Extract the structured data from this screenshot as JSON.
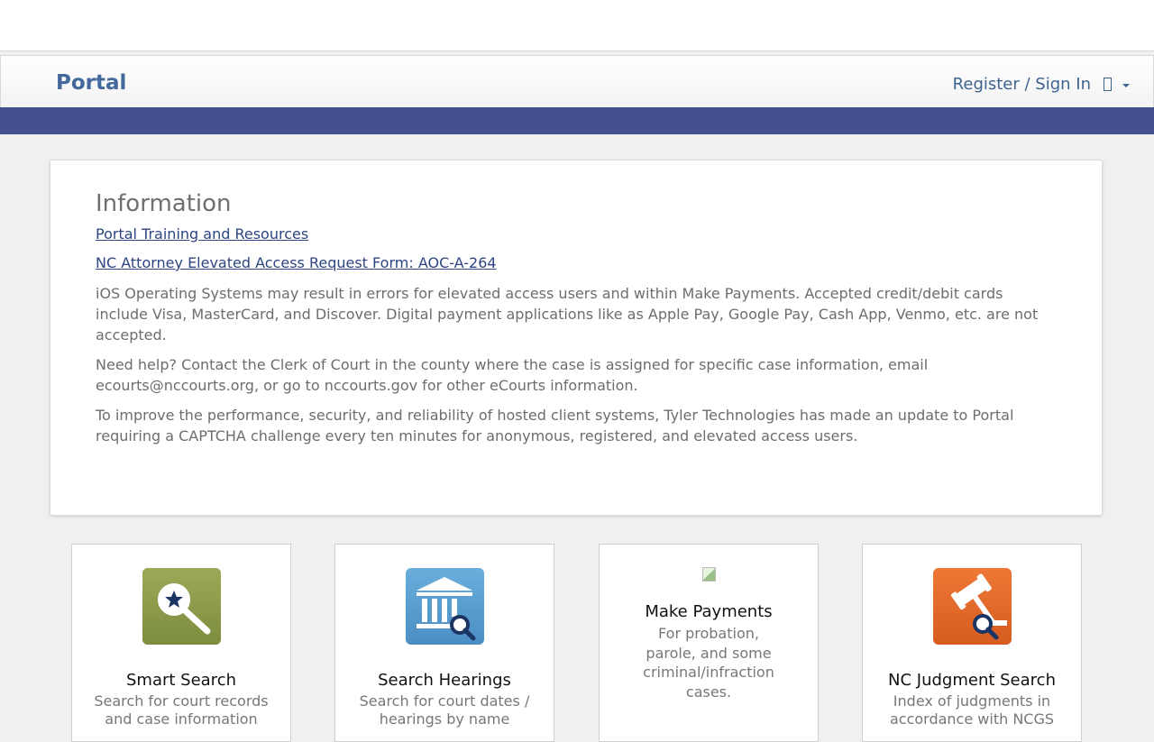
{
  "header": {
    "brand": "Portal",
    "signin_label": "Register / Sign In"
  },
  "info": {
    "heading": "Information",
    "links": [
      "Portal Training and Resources",
      "NC Attorney Elevated Access Request Form: AOC-A-264"
    ],
    "paragraphs": [
      "iOS Operating Systems may result in errors for elevated access users and within Make Payments. Accepted credit/debit cards include Visa, MasterCard, and Discover. Digital payment applications like as Apple Pay, Google Pay, Cash App, Venmo, etc. are not accepted.",
      "Need help? Contact the Clerk of Court in the county where the case is assigned for specific case information, email ecourts@nccourts.org, or go to nccourts.gov for other eCourts information.",
      "To improve the performance, security, and reliability of hosted client systems, Tyler Technologies has made an update to Portal requiring a CAPTCHA challenge every ten minutes for anonymous, registered, and elevated access users."
    ]
  },
  "tiles": [
    {
      "title": "Smart Search",
      "desc": "Search for court records and case information",
      "icon": "magnifier-star-icon",
      "color": "#8a9a48"
    },
    {
      "title": "Search Hearings",
      "desc": "Search for court dates / hearings by name",
      "icon": "courthouse-search-icon",
      "color": "#5b9fd0"
    },
    {
      "title": "Make Payments",
      "desc": "For probation, parole, and some criminal/infraction cases.",
      "icon": "broken-image-icon"
    },
    {
      "title": "NC Judgment Search",
      "desc": "Index of judgments in accordance with NCGS",
      "icon": "gavel-search-icon",
      "color": "#e0682a"
    }
  ],
  "colors": {
    "brand_text": "#43689a",
    "band": "#43508f",
    "link": "#2d4580"
  }
}
